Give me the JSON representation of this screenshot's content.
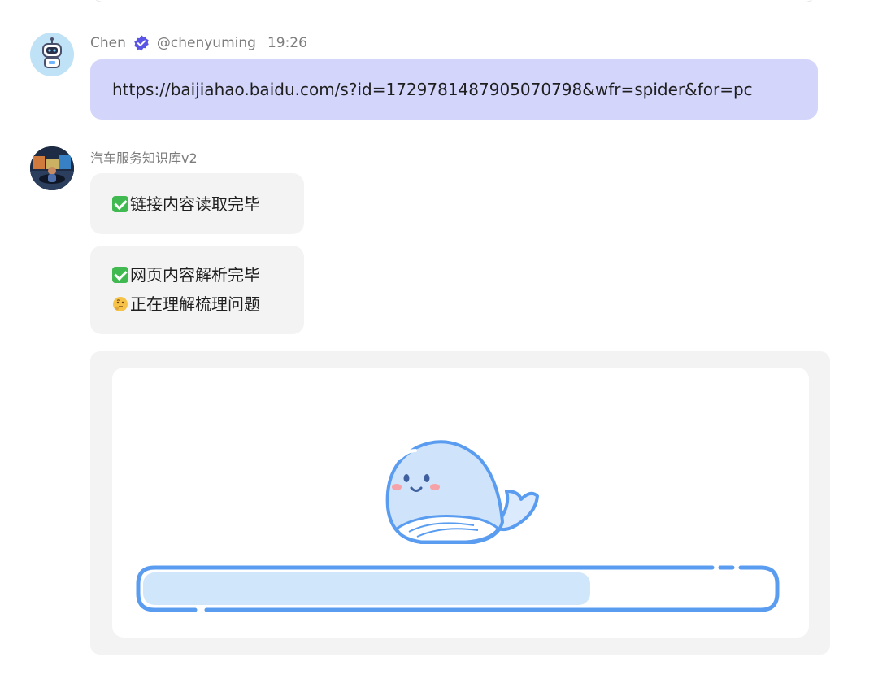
{
  "messages": {
    "user": {
      "name": "Chen",
      "handle": "@chenyuming",
      "time": "19:26",
      "text": "https://baijiahao.baidu.com/s?id=1729781487905070798&wfr=spider&for=pc",
      "avatar_icon": "robot-avatar-icon",
      "badge_icon": "verified-badge-icon"
    },
    "bot": {
      "name": "汽车服务知识库v2",
      "avatar_icon": "bot-avatar-icon",
      "status_1": "链接内容读取完毕",
      "status_2": "网页内容解析完毕",
      "status_3": "正在理解梳理问题",
      "status_icons": [
        "check-mark-icon",
        "check-mark-icon",
        "thinking-face-icon"
      ]
    }
  },
  "loading": {
    "mascot_icon": "whale-mascot-icon",
    "progress_fraction": 0.71,
    "progress_color": "#cfe6fb",
    "outline_color": "#5a9cf0"
  },
  "colors": {
    "user_bubble": "#d3d5fb",
    "bot_bubble": "#f3f3f3",
    "verified_badge": "#5b55e6"
  }
}
